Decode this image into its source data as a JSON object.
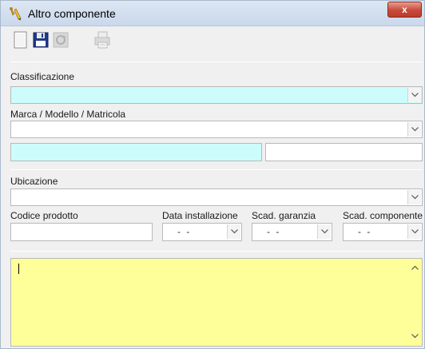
{
  "window": {
    "title": "Altro componente",
    "close_label": "x",
    "app_icon": "wrench-pencil-icon"
  },
  "toolbar": {
    "buttons": [
      {
        "name": "new-document-icon",
        "enabled": true
      },
      {
        "name": "save-icon",
        "enabled": true
      },
      {
        "name": "refresh-icon",
        "enabled": false
      },
      {
        "name": "print-icon",
        "enabled": false
      }
    ]
  },
  "form": {
    "classificazione_label": "Classificazione",
    "marca_label": "Marca / Modello / Matricola",
    "ubicazione_label": "Ubicazione",
    "codice_label": "Codice prodotto",
    "data_installazione_label": "Data installazione",
    "scad_garanzia_label": "Scad. garanzia",
    "scad_componente_label": "Scad. componente",
    "data_installazione_value": "- -",
    "scad_garanzia_value": "- -",
    "scad_componente_value": "- -"
  },
  "colors": {
    "required_field": "#ccfcfc",
    "notes_field": "#ffff99"
  }
}
